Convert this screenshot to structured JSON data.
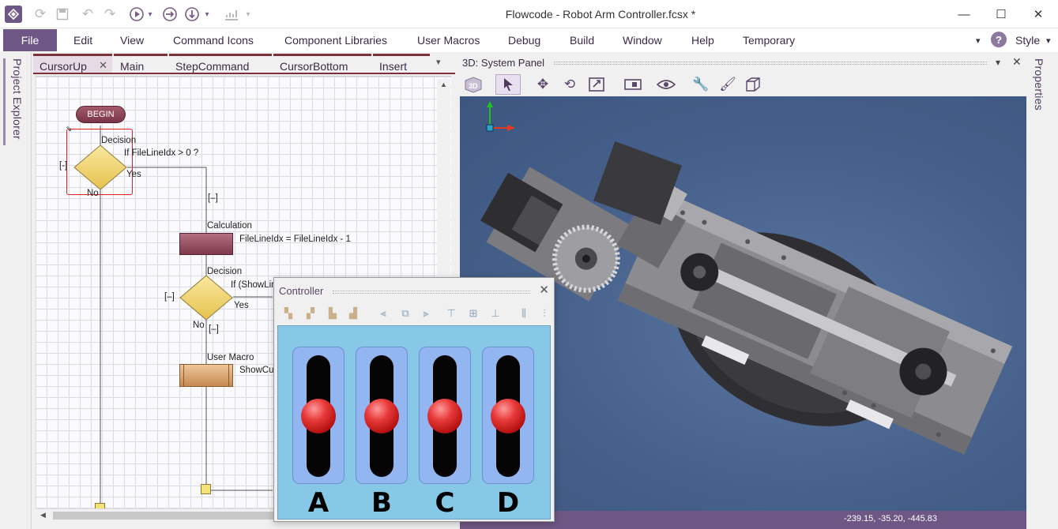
{
  "window": {
    "title": "Flowcode - Robot Arm Controller.fcsx *"
  },
  "menu": {
    "file": "File",
    "items": [
      "Edit",
      "View",
      "Command Icons",
      "Component Libraries",
      "User Macros",
      "Debug",
      "Build",
      "Window",
      "Help",
      "Temporary"
    ],
    "style": "Style"
  },
  "docks": {
    "left": "Project Explorer",
    "right": "Properties"
  },
  "flowchart": {
    "tabs": [
      "CursorUp",
      "Main",
      "StepCommand",
      "CursorBottom",
      "Insert"
    ],
    "active_tab": 0,
    "begin": "BEGIN",
    "decision1": {
      "label": "Decision",
      "condition": "If FileLineIdx > 0 ?",
      "yes": "Yes",
      "no": "No",
      "collapse": "[-]"
    },
    "collapse_marker": "[–]",
    "calculation": {
      "label": "Calculation",
      "expression": "FileLineIdx = FileLineIdx - 1"
    },
    "decision2": {
      "label": "Decision",
      "condition": "If (ShowLin",
      "yes": "Yes",
      "no": "No",
      "collapse": "[–]",
      "collapse_below": "[–]"
    },
    "user_macro": {
      "label": "User Macro",
      "call": "ShowCur"
    }
  },
  "system_panel": {
    "title": "3D: System Panel",
    "coords": "-239.15, -35.20, -445.83",
    "accent": "#6e5784"
  },
  "controller": {
    "title": "Controller",
    "sliders": [
      {
        "letter": "A",
        "level": 0.5
      },
      {
        "letter": "B",
        "level": 0.5
      },
      {
        "letter": "C",
        "level": 0.5
      },
      {
        "letter": "D",
        "level": 0.5
      }
    ]
  }
}
